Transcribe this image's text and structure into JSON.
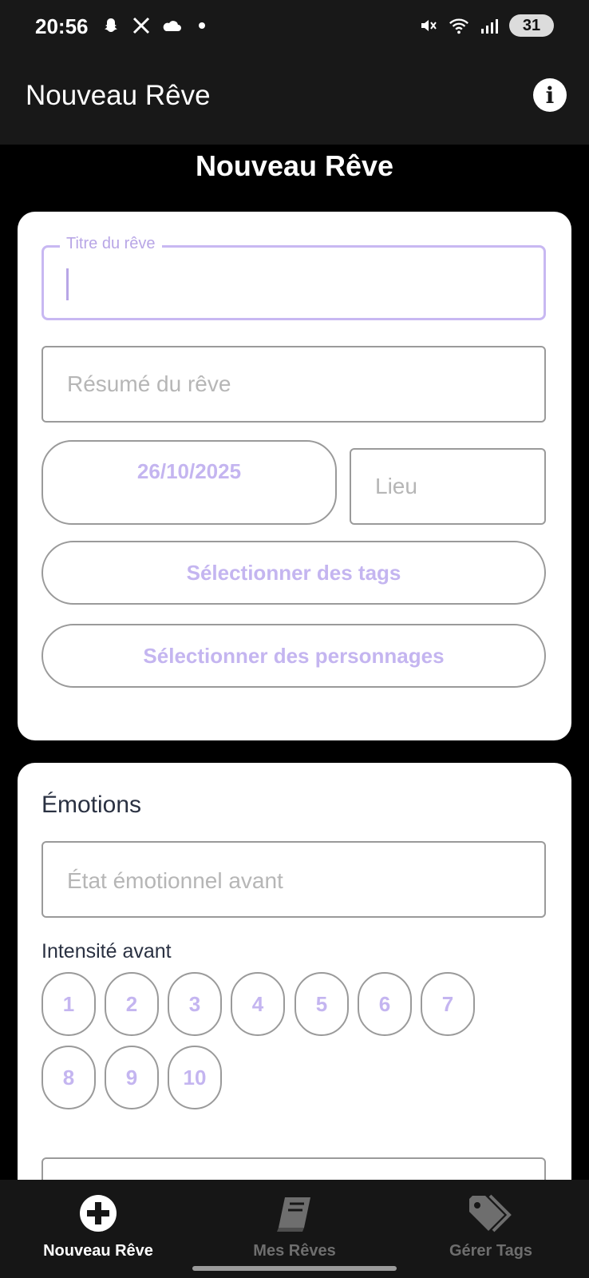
{
  "status_bar": {
    "time": "20:56",
    "battery": "31",
    "icons": [
      "snapchat-icon",
      "x-icon",
      "cloud-icon",
      "dot-icon",
      "mute-icon",
      "wifi-icon",
      "signal-icon",
      "battery-icon"
    ]
  },
  "app_bar": {
    "title": "Nouveau Rêve",
    "info_icon": "info-icon"
  },
  "page": {
    "title": "Nouveau Rêve"
  },
  "form": {
    "title_label": "Titre du rêve",
    "summary_placeholder": "Résumé du rêve",
    "date": "26/10/2025",
    "location_placeholder": "Lieu",
    "select_tags": "Sélectionner des tags",
    "select_characters": "Sélectionner des personnages"
  },
  "emotions": {
    "section_title": "Émotions",
    "state_before_placeholder": "État émotionnel avant",
    "intensity_before_label": "Intensité avant",
    "intensity_values": [
      "1",
      "2",
      "3",
      "4",
      "5",
      "6",
      "7",
      "8",
      "9",
      "10"
    ]
  },
  "bottom_nav": {
    "items": [
      {
        "label": "Nouveau Rêve",
        "icon": "plus-circle-icon",
        "active": true
      },
      {
        "label": "Mes Rêves",
        "icon": "book-icon",
        "active": false
      },
      {
        "label": "Gérer Tags",
        "icon": "tags-icon",
        "active": false
      }
    ],
    "colors": {
      "active": "#ffffff",
      "inactive": "#6e6e6e"
    }
  },
  "colors": {
    "accent": "#c4b5f0",
    "card_bg": "#ffffff",
    "app_bg": "#000000",
    "bar_bg": "#181818"
  }
}
